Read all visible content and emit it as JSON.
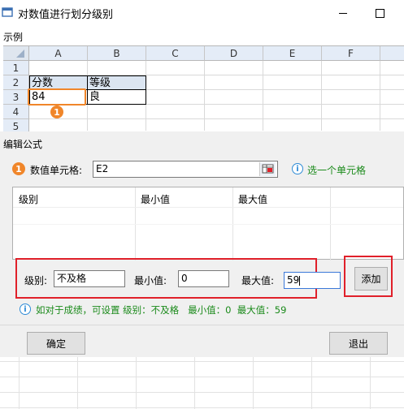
{
  "window": {
    "title": "对数值进行划分级别"
  },
  "example": {
    "section_label": "示例",
    "columns": [
      "A",
      "B",
      "C",
      "D",
      "E",
      "F"
    ],
    "rows": [
      "1",
      "2",
      "3",
      "4",
      "5"
    ],
    "cells": {
      "A2": "分数",
      "B2": "等级",
      "A3": "84",
      "B3": "良"
    },
    "marker": "1"
  },
  "editor": {
    "section_label": "编辑公式",
    "step_marker": "1",
    "value_cell_label": "数值单元格:",
    "value_cell_value": "E2",
    "select_hint": "选一个单元格",
    "list_headers": [
      "级别",
      "最小值",
      "最大值"
    ],
    "level_label": "级别:",
    "level_value": "不及格",
    "min_label": "最小值:",
    "min_value": "0",
    "max_label": "最大值:",
    "max_value": "59",
    "add_button": "添加",
    "tip_text": "如对于成绩，可设置 级别：不及格   最小值：0  最大值：59"
  },
  "footer": {
    "ok_button": "确定",
    "exit_button": "退出"
  },
  "colors": {
    "accent_orange": "#f0862a",
    "highlight_red": "#e0202a",
    "hint_green": "#1a8a1a",
    "info_blue": "#2e8bd6"
  }
}
